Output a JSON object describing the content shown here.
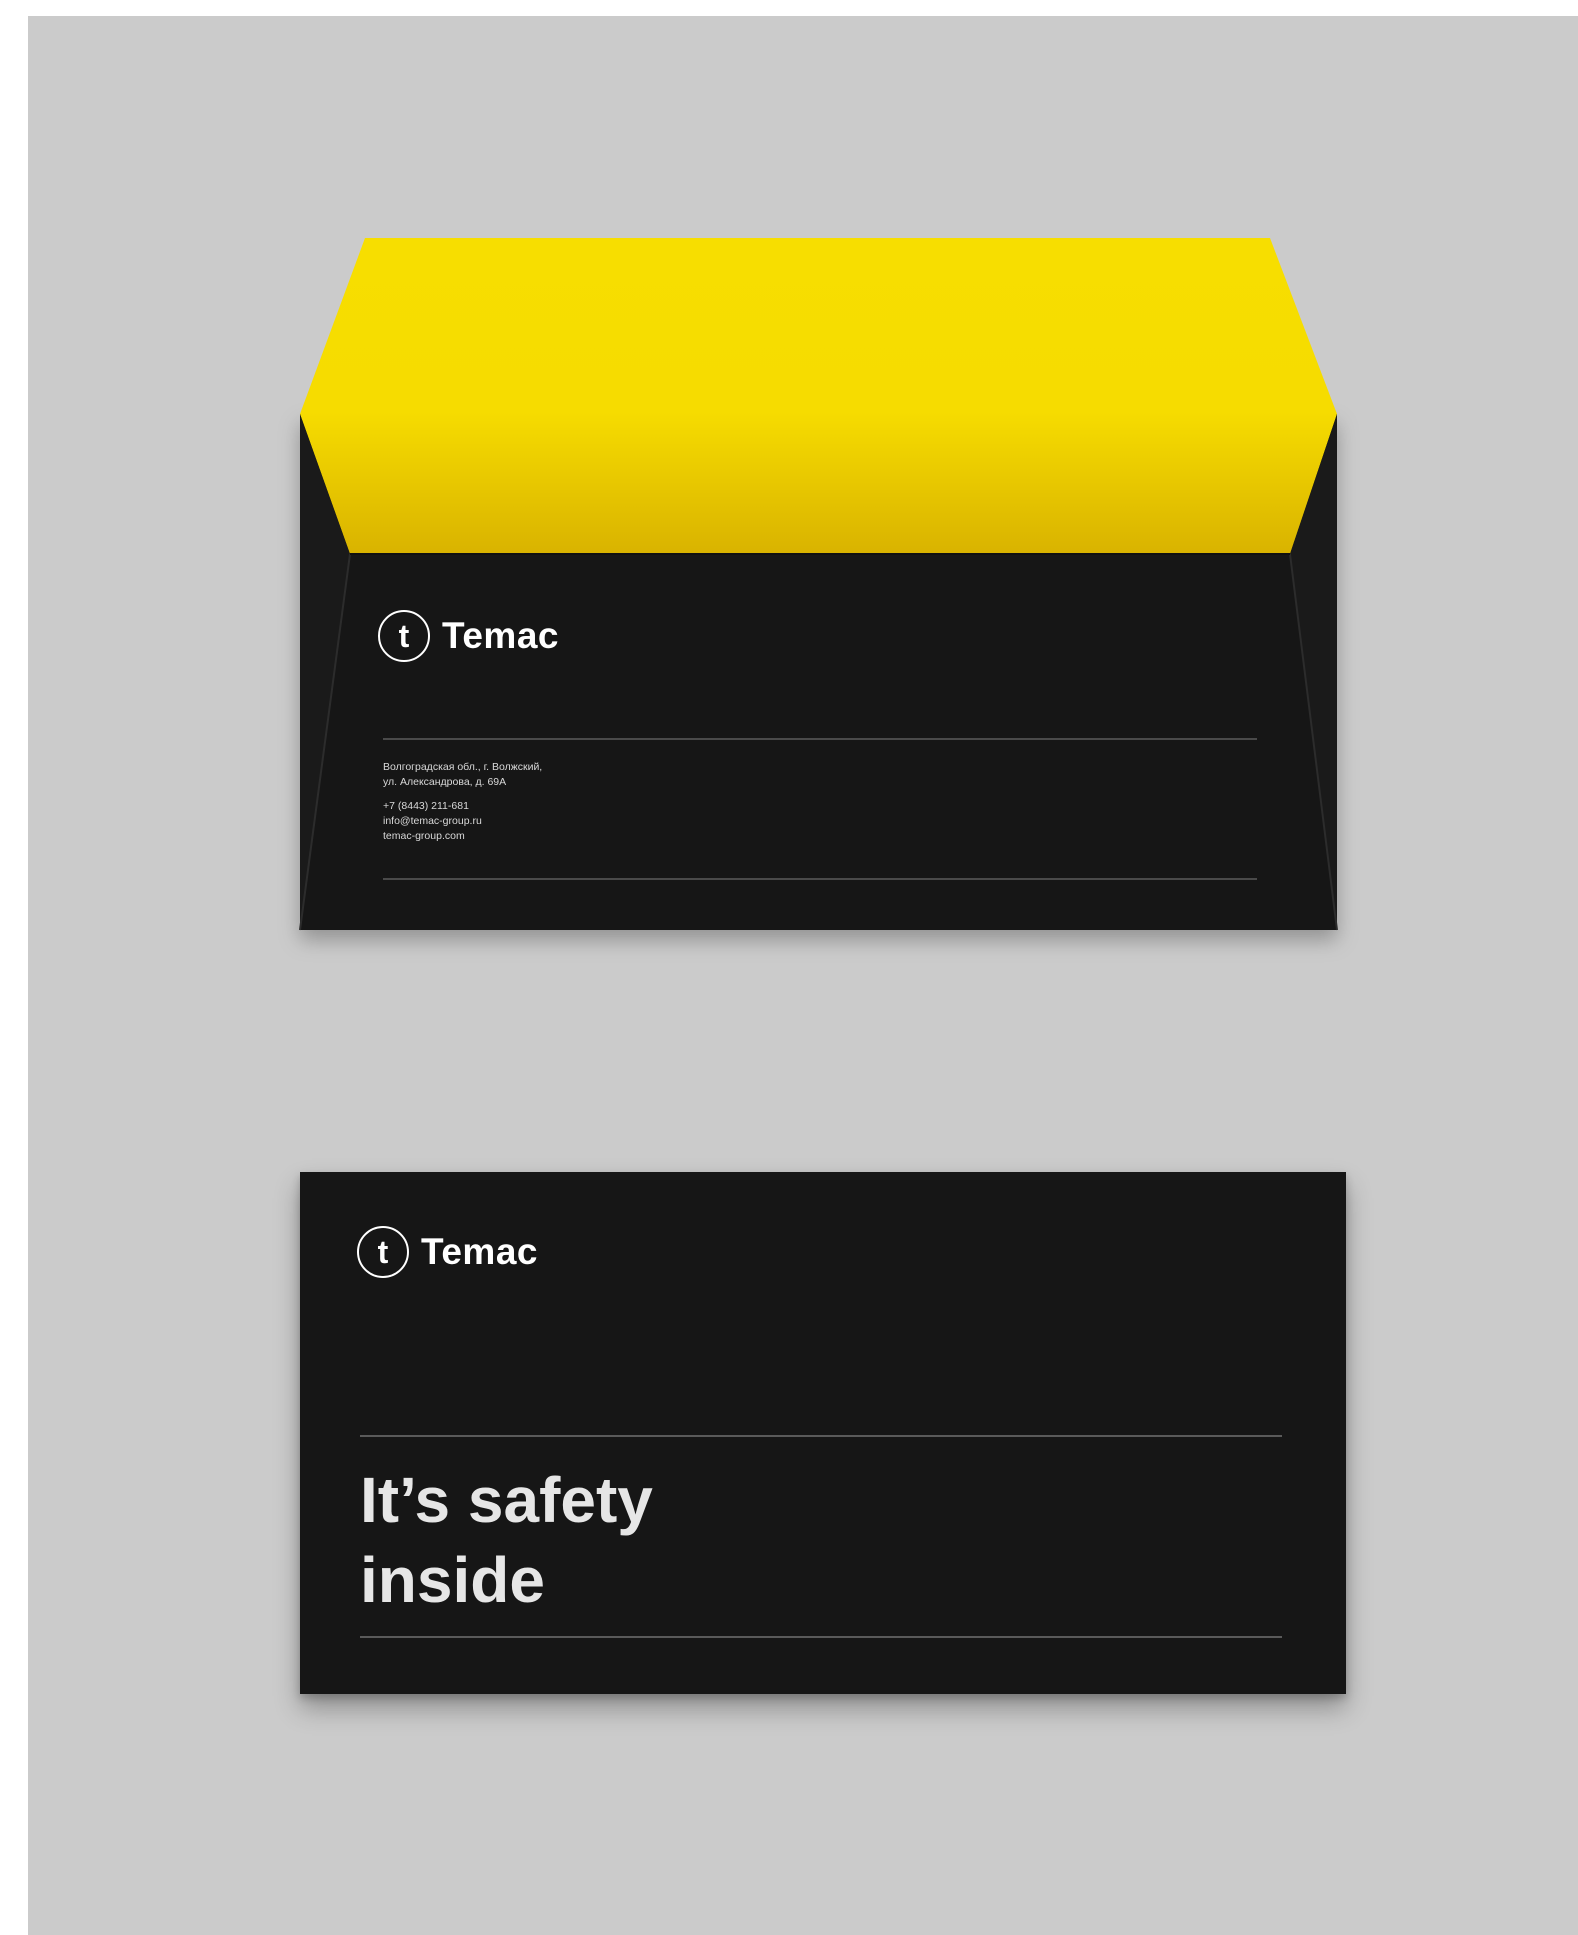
{
  "brand": {
    "name": "Temac",
    "mark": "t"
  },
  "back": {
    "address_line_1": "Волгоградская обл., г. Волжский,",
    "address_line_2": "ул. Александрова, д. 69А",
    "phone": "+7 (8443) 211-681",
    "email": "info@temac-group.ru",
    "website": "temac-group.com"
  },
  "front": {
    "slogan_line_1": "It’s safety",
    "slogan_line_2": "inside"
  },
  "colors": {
    "background": "#cbcbcb",
    "envelope": "#161616",
    "flap_yellow": "#f5d800",
    "text": "#ffffff"
  }
}
